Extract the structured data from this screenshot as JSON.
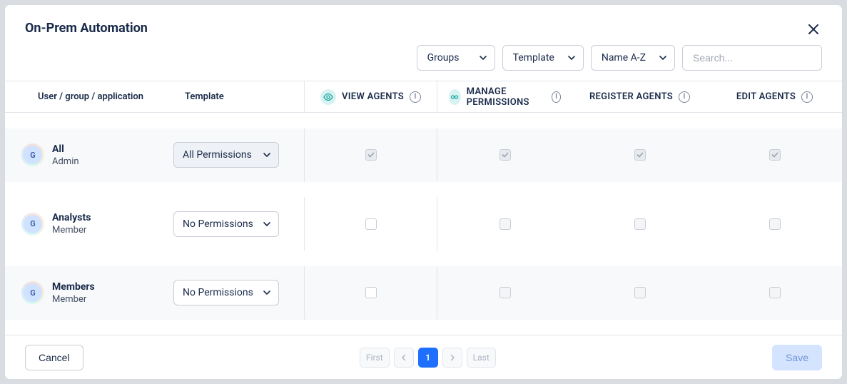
{
  "title": "On-Prem Automation",
  "toolbar": {
    "filter_groups": "Groups",
    "filter_template": "Template",
    "sort": "Name A-Z",
    "search_placeholder": "Search..."
  },
  "columns": {
    "left_name": "User / group / application",
    "left_template": "Template",
    "perms": [
      {
        "label": "VIEW AGENTS",
        "icon": "eye"
      },
      {
        "label": "MANAGE PERMISSIONS",
        "icon": "mask"
      },
      {
        "label": "REGISTER AGENTS",
        "icon": "none"
      },
      {
        "label": "EDIT AGENTS",
        "icon": "none"
      }
    ]
  },
  "rows": [
    {
      "badge": "G",
      "name": "All",
      "role": "Admin",
      "template": "All Permissions",
      "template_shaded": true,
      "checks": [
        "checked",
        "checked",
        "checked",
        "checked"
      ]
    },
    {
      "badge": "G",
      "name": "Analysts",
      "role": "Member",
      "template": "No Permissions",
      "template_shaded": false,
      "checks": [
        "empty",
        "disabled",
        "disabled",
        "disabled"
      ]
    },
    {
      "badge": "G",
      "name": "Members",
      "role": "Member",
      "template": "No Permissions",
      "template_shaded": false,
      "checks": [
        "empty",
        "disabled",
        "disabled",
        "disabled"
      ]
    }
  ],
  "pager": {
    "first": "First",
    "last": "Last",
    "current": "1"
  },
  "footer": {
    "cancel": "Cancel",
    "save": "Save"
  }
}
